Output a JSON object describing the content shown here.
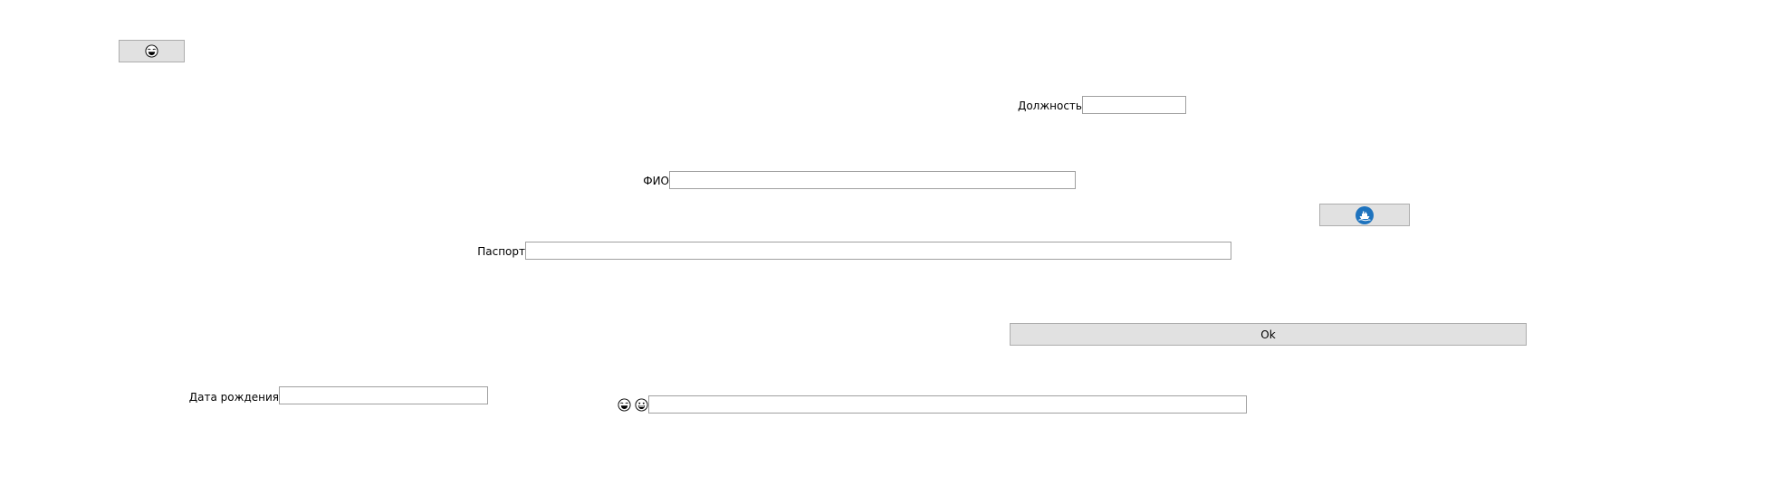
{
  "form": {
    "top_emoji_button": {
      "icon": "laughing-face-icon"
    },
    "position": {
      "label": "Должность",
      "value": ""
    },
    "full_name": {
      "label": "ФИО",
      "value": ""
    },
    "ship_button": {
      "icon": "ship-icon",
      "accent": "#1e73be"
    },
    "passport": {
      "label": "Паспорт",
      "value": ""
    },
    "ok_button": {
      "label": "Ok"
    },
    "birth_date": {
      "label": "Дата рождения",
      "value": ""
    },
    "emoji_field": {
      "icons": [
        "laughing-face-icon",
        "grinning-face-icon"
      ],
      "value": ""
    }
  }
}
